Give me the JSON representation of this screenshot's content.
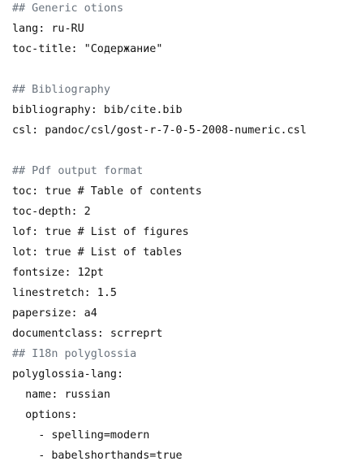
{
  "code": {
    "lines": [
      {
        "text": "## Generic otions",
        "type": "comment"
      },
      {
        "text": "lang: ru-RU",
        "type": "key"
      },
      {
        "text": "toc-title: \"Содержание\"",
        "type": "key"
      },
      {
        "text": "",
        "type": "blank"
      },
      {
        "text": "## Bibliography",
        "type": "comment"
      },
      {
        "text": "bibliography: bib/cite.bib",
        "type": "key"
      },
      {
        "text": "csl: pandoc/csl/gost-r-7-0-5-2008-numeric.csl",
        "type": "key"
      },
      {
        "text": "",
        "type": "blank"
      },
      {
        "text": "## Pdf output format",
        "type": "comment"
      },
      {
        "text": "toc: true # Table of contents",
        "type": "key"
      },
      {
        "text": "toc-depth: 2",
        "type": "key"
      },
      {
        "text": "lof: true # List of figures",
        "type": "key"
      },
      {
        "text": "lot: true # List of tables",
        "type": "key"
      },
      {
        "text": "fontsize: 12pt",
        "type": "key"
      },
      {
        "text": "linestretch: 1.5",
        "type": "key"
      },
      {
        "text": "papersize: a4",
        "type": "key"
      },
      {
        "text": "documentclass: scrreprt",
        "type": "key"
      },
      {
        "text": "## I18n polyglossia",
        "type": "comment"
      },
      {
        "text": "polyglossia-lang:",
        "type": "key"
      },
      {
        "text": "  name: russian",
        "type": "key"
      },
      {
        "text": "  options:",
        "type": "key"
      },
      {
        "text": "    - spelling=modern",
        "type": "key"
      },
      {
        "text": "    - babelshorthands=true",
        "type": "key"
      }
    ]
  }
}
